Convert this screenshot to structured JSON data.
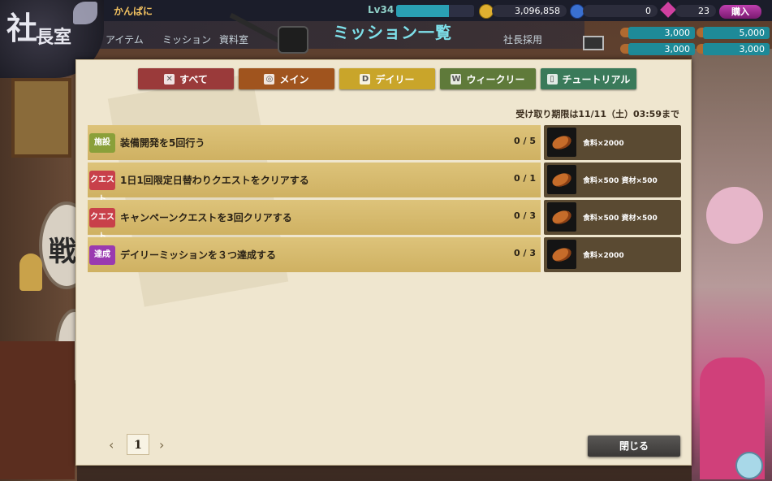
{
  "header": {
    "player_name": "かんぱに",
    "level_label": "Lv34",
    "xp_progress": 0.68,
    "gold": "3,096,858",
    "secondary_currency": "0",
    "gems": "23",
    "buy_label": "購入",
    "logo_text_1": "社",
    "logo_text_2": "長室"
  },
  "nav": {
    "items": [
      "アイテム",
      "ミッション",
      "資料室",
      "社長採用"
    ],
    "page_title": "ミッション一覧"
  },
  "resources": [
    "3,000",
    "5,000",
    "3,000",
    "3,000"
  ],
  "background": {
    "side_button_label": "戦"
  },
  "tabs": [
    {
      "label": "すべて",
      "icon": "crossed-swords-icon",
      "color": "#9a3a3a"
    },
    {
      "label": "メイン",
      "icon": "circle-icon",
      "color": "#a0541e"
    },
    {
      "label": "デイリー",
      "icon": "D",
      "color": "#c9a52a"
    },
    {
      "label": "ウィークリー",
      "icon": "W",
      "color": "#5f7a3a"
    },
    {
      "label": "チュートリアル",
      "icon": "book-icon",
      "color": "#3a7a5a"
    }
  ],
  "deadline": "受け取り期限は11/11（土）03:59まで",
  "missions": [
    {
      "badge": "施設",
      "badge_color": "#8aa03a",
      "text": "装備開発を5回行う",
      "progress": "0 / 5",
      "reward": "食料×2000"
    },
    {
      "badge": "クエスト",
      "badge_color": "#c8404a",
      "text": "1日1回限定日替わりクエストをクリアする",
      "progress": "0 / 1",
      "reward": "食料×500 資材×500"
    },
    {
      "badge": "クエスト",
      "badge_color": "#c8404a",
      "text": "キャンペーンクエストを3回クリアする",
      "progress": "0 / 3",
      "reward": "食料×500 資材×500"
    },
    {
      "badge": "達成",
      "badge_color": "#9a3ab0",
      "text": "デイリーミッションを３つ達成する",
      "progress": "0 / 3",
      "reward": "食料×2000"
    }
  ],
  "pager": {
    "current": "1",
    "prev": "‹",
    "next": "›"
  },
  "close_label": "閉じる"
}
